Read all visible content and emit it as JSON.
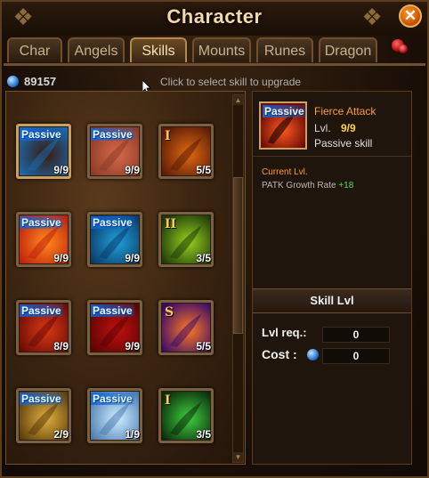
{
  "window": {
    "title": "Character",
    "close_label": "✕"
  },
  "tabs": [
    {
      "label": "Char",
      "active": false
    },
    {
      "label": "Angels",
      "active": false
    },
    {
      "label": "Skills",
      "active": true
    },
    {
      "label": "Mounts",
      "active": false
    },
    {
      "label": "Runes",
      "active": false
    },
    {
      "label": "Dragon",
      "active": false
    }
  ],
  "currency": {
    "icon": "blue-orb-icon",
    "value": "89157"
  },
  "hint": "Click to select skill to upgrade",
  "skills": [
    {
      "tag": "Passive",
      "level": "9/9",
      "icon": "boot-icon",
      "colors": [
        "#1a6ab0",
        "#3a1a0a"
      ]
    },
    {
      "tag": "Passive",
      "level": "9/9",
      "icon": "rose-icon",
      "colors": [
        "#8a3a28",
        "#d86a4a"
      ]
    },
    {
      "tag": "I",
      "level": "5/5",
      "icon": "spear-icon",
      "colors": [
        "#5a1a08",
        "#e06a10"
      ]
    },
    {
      "tag": "Passive",
      "level": "9/9",
      "icon": "flame-blade-icon",
      "colors": [
        "#c02008",
        "#ff8a20"
      ]
    },
    {
      "tag": "Passive",
      "level": "9/9",
      "icon": "ice-splash-icon",
      "colors": [
        "#0a3a6a",
        "#20a0d8"
      ]
    },
    {
      "tag": "II",
      "level": "3/5",
      "icon": "poison-whirl-icon",
      "colors": [
        "#1a3a08",
        "#9ad020"
      ]
    },
    {
      "tag": "Passive",
      "level": "8/9",
      "icon": "armor-icon",
      "colors": [
        "#6a0a04",
        "#d83a18"
      ]
    },
    {
      "tag": "Passive",
      "level": "9/9",
      "icon": "cape-icon",
      "colors": [
        "#5a0404",
        "#c01010"
      ]
    },
    {
      "tag": "S",
      "level": "5/5",
      "icon": "lance-strike-icon",
      "colors": [
        "#3a0a6a",
        "#ff7a20"
      ]
    },
    {
      "tag": "Passive",
      "level": "2/9",
      "icon": "golden-armor-icon",
      "colors": [
        "#5a3a08",
        "#e0b040"
      ]
    },
    {
      "tag": "Passive",
      "level": "1/9",
      "icon": "crystal-icon",
      "colors": [
        "#4a7ab0",
        "#d0f0ff"
      ]
    },
    {
      "tag": "I",
      "level": "3/5",
      "icon": "green-rain-icon",
      "colors": [
        "#0a2a0a",
        "#40d040"
      ]
    }
  ],
  "detail": {
    "tag": "Passive",
    "name": "Fierce Attack",
    "level_label": "Lvl.",
    "level_value": "9/9",
    "type": "Passive skill",
    "current_label": "Current Lvl.",
    "stat_name": "PATK Growth Rate",
    "stat_bonus": "+18"
  },
  "upgrade": {
    "header": "Skill Lvl",
    "req_label": "Lvl req.:",
    "req_value": "0",
    "cost_label": "Cost :",
    "cost_value": "0"
  }
}
